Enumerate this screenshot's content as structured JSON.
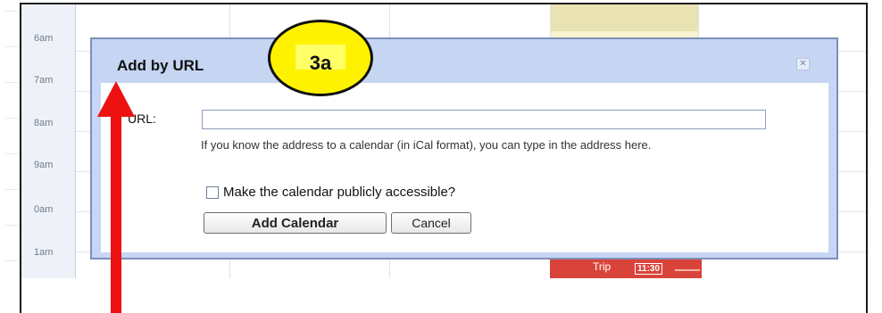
{
  "calendar": {
    "hours": [
      "6am",
      "7am",
      "8am",
      "9am",
      "0am",
      "1am"
    ],
    "event": {
      "title": "Trip",
      "time": "11:30"
    }
  },
  "dialog": {
    "title": "Add by URL",
    "close_icon": "close-icon",
    "url_label": "URL:",
    "url_value": "",
    "helper_text": "If you know the address to a calendar (in iCal format), you can type in the address here.",
    "public_checkbox_label": "Make the calendar publicly accessible?",
    "public_checked": false,
    "add_button": "Add Calendar",
    "cancel_button": "Cancel"
  },
  "annotation": {
    "callout_label": "3a",
    "callout_color": "#fff200",
    "arrow_color": "#ee1111"
  }
}
